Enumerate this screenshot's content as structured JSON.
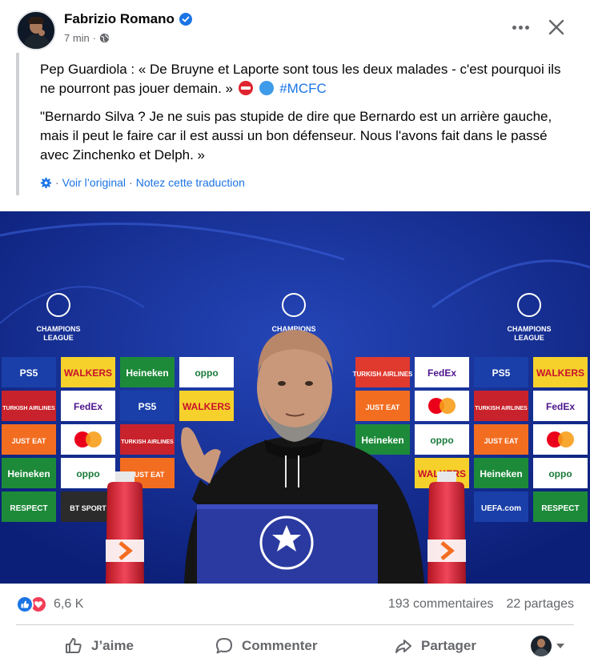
{
  "post": {
    "author": "Fabrizio Romano",
    "time": "7 min",
    "meta_sep": "·",
    "paragraph1": "Pep Guardiola : « De Bruyne et Laporte sont tous les deux malades - c'est pourquoi ils ne pourront pas jouer demain. »",
    "hashtag": "#MCFC",
    "paragraph2": "\"Bernardo Silva ? Je ne suis pas stupide de dire que Bernardo est un arrière gauche, mais il peut le faire car il est aussi un bon défenseur. Nous l'avons fait dans le passé avec Zinchenko et Delph. »",
    "translation": {
      "see_original": "Voir l’original",
      "separator": "·",
      "rate": "Notez cette traduction"
    }
  },
  "photo": {
    "cl_label_line1": "CHAMPIONS",
    "cl_label_line2": "LEAGUE",
    "sponsors": [
      "PS5",
      "WALKERS",
      "Heineken",
      "oppo",
      "TURKISH AIRLINES",
      "FedEx",
      "JUST EAT",
      "mastercard",
      "BT SPORT",
      "RESPECT",
      "UEFA.com"
    ]
  },
  "stats": {
    "reaction_count": "6,6 K",
    "comments": "193 commentaires",
    "shares": "22 partages"
  },
  "actions": {
    "like": "J’aime",
    "comment": "Commenter",
    "share": "Partager"
  },
  "colors": {
    "accent": "#1b74e4",
    "secondary_text": "#65676b",
    "love": "#f33e58",
    "backdrop": "#13298c"
  }
}
